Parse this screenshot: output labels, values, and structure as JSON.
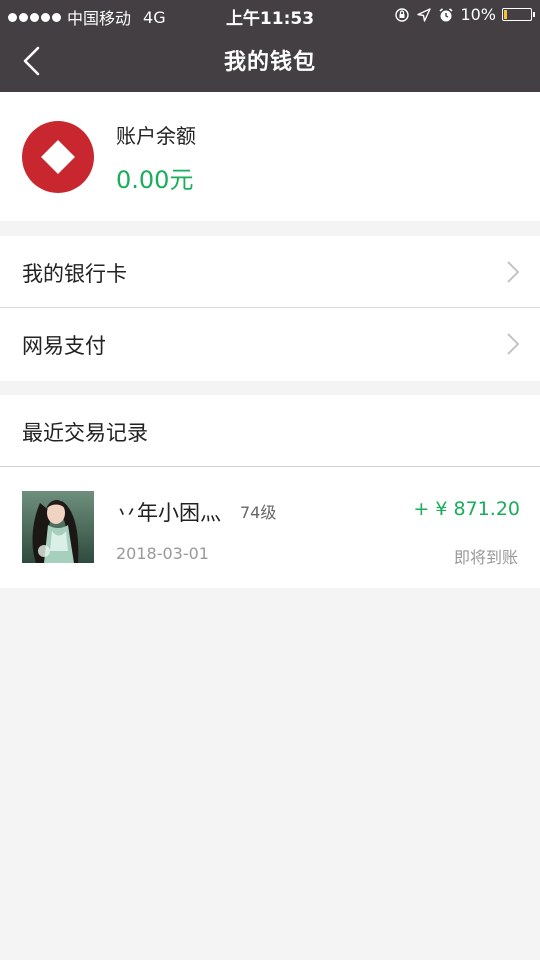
{
  "status_bar": {
    "carrier": "中国移动",
    "network": "4G",
    "time": "上午11:53",
    "battery": "10%",
    "battery_level": 0.1
  },
  "nav": {
    "title": "我的钱包"
  },
  "balance": {
    "label": "账户余额",
    "amount": "0.00元"
  },
  "menu": {
    "items": [
      {
        "label": "我的银行卡"
      },
      {
        "label": "网易支付"
      }
    ]
  },
  "transactions": {
    "header": "最近交易记录",
    "items": [
      {
        "name": "丷年小困灬",
        "level": "74级",
        "amount": "+ ¥ 871.20",
        "date": "2018-03-01",
        "status": "即将到账"
      }
    ]
  },
  "colors": {
    "nav_bg": "#433f42",
    "accent_green": "#1aad5b",
    "logo_red": "#c9272f"
  }
}
